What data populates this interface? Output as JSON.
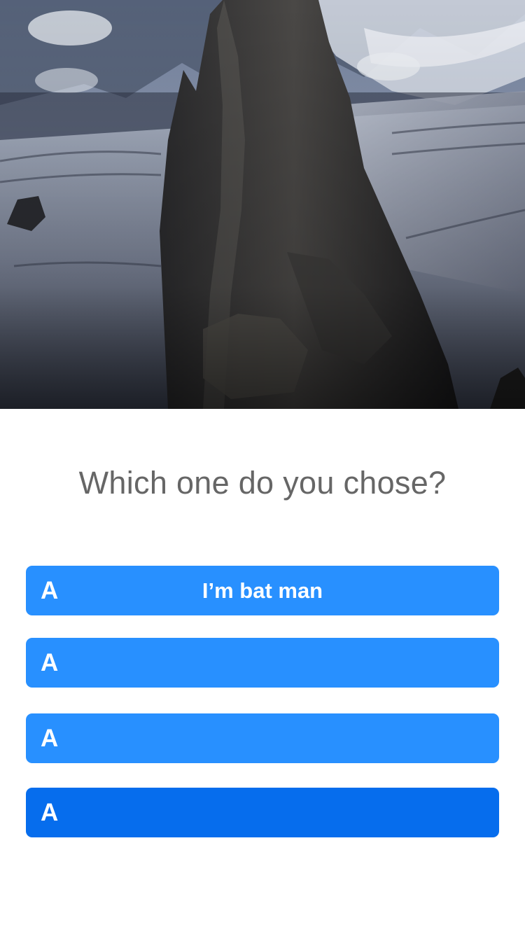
{
  "hero": {
    "image_name": "mountain-rock-spire-image"
  },
  "question": {
    "text": "Which one do you chose?"
  },
  "options": [
    {
      "letter": "A",
      "text": "I’m bat man",
      "state": "default"
    },
    {
      "letter": "A",
      "text": "",
      "state": "default"
    },
    {
      "letter": "A",
      "text": "",
      "state": "default"
    },
    {
      "letter": "A",
      "text": "",
      "state": "active"
    }
  ],
  "colors": {
    "option_default": "#2890ff",
    "option_active": "#066ded",
    "question_text": "#666666",
    "option_text": "#ffffff"
  }
}
